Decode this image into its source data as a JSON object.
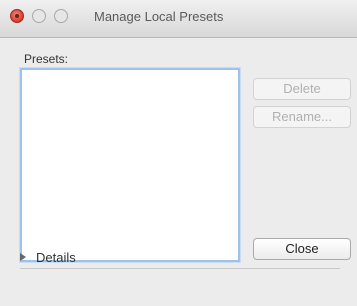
{
  "window": {
    "title": "Manage Local Presets"
  },
  "presets": {
    "label": "Presets:",
    "items": []
  },
  "buttons": {
    "delete_label": "Delete",
    "rename_label": "Rename...",
    "close_label": "Close"
  },
  "details": {
    "label": "Details",
    "icon": "disclosure-triangle-icon",
    "expanded": false
  },
  "colors": {
    "list_focus_border": "#9ec3ea",
    "close_button": "#d23b2c"
  }
}
